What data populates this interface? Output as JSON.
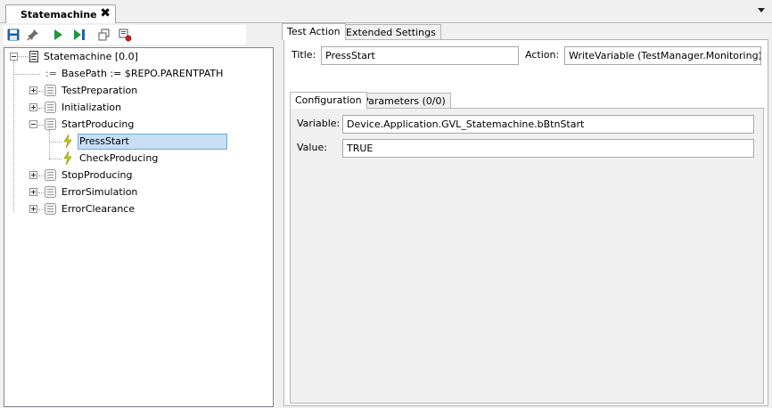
{
  "document_tab": {
    "title": "Statemachine",
    "close_glyph": "✖"
  },
  "toolbar": {
    "buttons": [
      "save-icon",
      "pin-icon",
      "run-icon",
      "step-icon",
      "copy-icon",
      "record-icon"
    ],
    "accent": "#1e5fa8",
    "run_color": "#1d9a3b"
  },
  "tree": {
    "root": {
      "label": "Statemachine [0.0]"
    },
    "items": [
      {
        "label": "BasePath := $REPO.PARENTPATH",
        "kind": "variable"
      },
      {
        "label": "TestPreparation",
        "kind": "state",
        "expanded": false
      },
      {
        "label": "Initialization",
        "kind": "state",
        "expanded": false
      },
      {
        "label": "StartProducing",
        "kind": "state",
        "expanded": true
      },
      {
        "label": "PressStart",
        "kind": "action",
        "selected": true
      },
      {
        "label": "CheckProducing",
        "kind": "action"
      },
      {
        "label": "StopProducing",
        "kind": "state",
        "expanded": false
      },
      {
        "label": "ErrorSimulation",
        "kind": "state",
        "expanded": false
      },
      {
        "label": "ErrorClearance",
        "kind": "state",
        "expanded": false
      }
    ],
    "selected_color": "#c6dff5"
  },
  "right": {
    "tabs": [
      "Test Action",
      "Extended Settings"
    ],
    "title_label": "Title:",
    "title_value": "PressStart",
    "action_label": "Action:",
    "action_value": "WriteVariable (TestManager.Monitoring)",
    "inner_tabs": [
      "Configuration",
      "Parameters (0/0)"
    ],
    "variable_label": "Variable:",
    "variable_value": "Device.Application.GVL_Statemachine.bBtnStart",
    "value_label": "Value:",
    "value_value": "TRUE"
  }
}
